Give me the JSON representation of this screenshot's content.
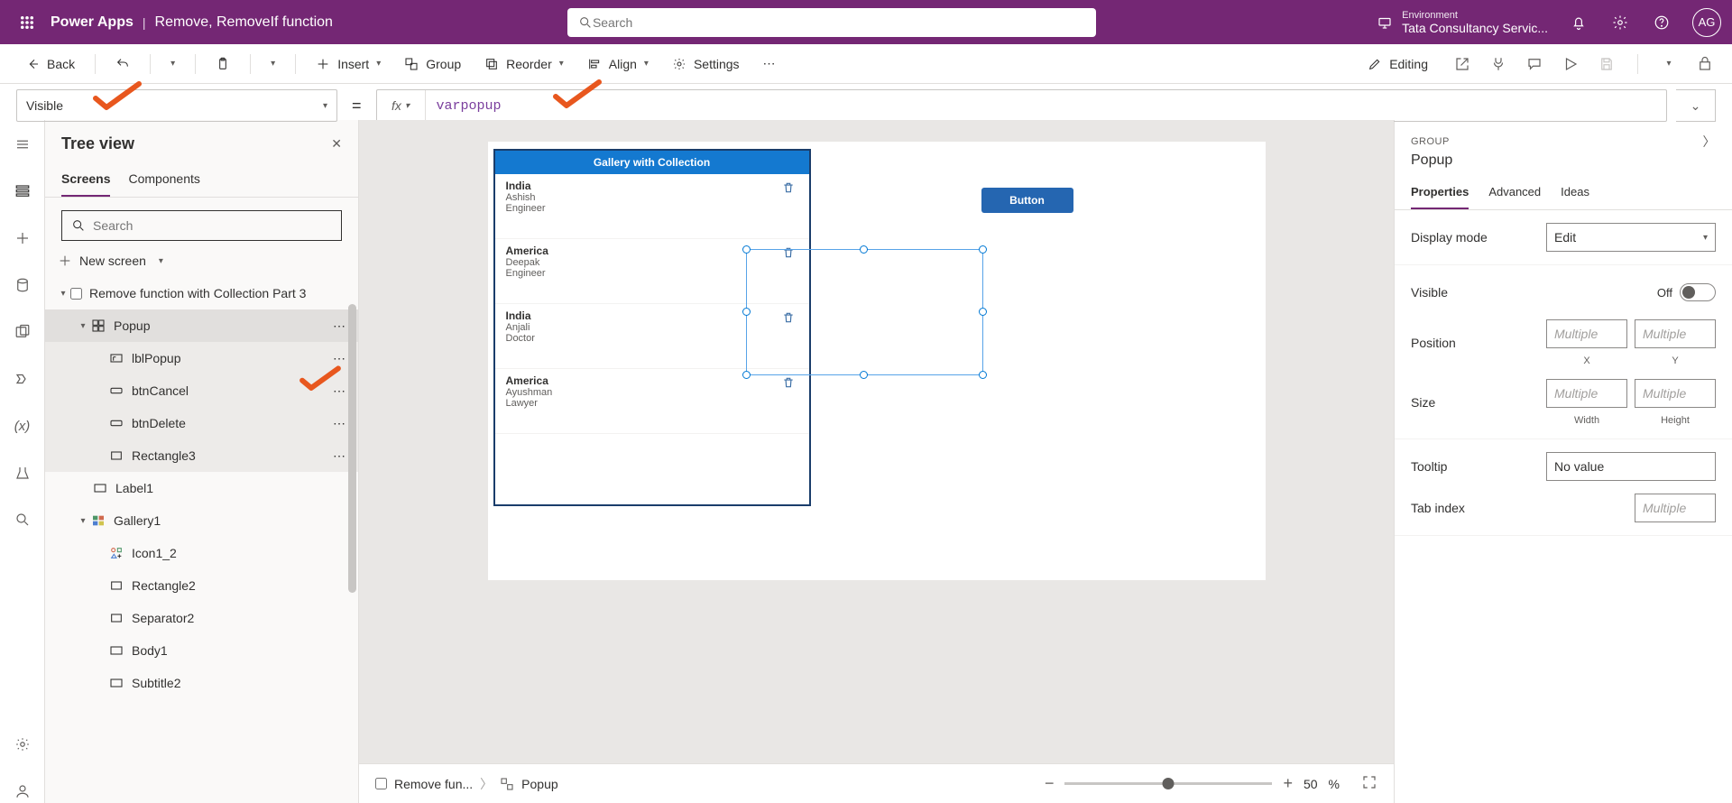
{
  "titlebar": {
    "app": "Power Apps",
    "doc": "Remove, RemoveIf function",
    "search_ph": "Search",
    "env_label": "Environment",
    "env_value": "Tata Consultancy Servic...",
    "avatar": "AG"
  },
  "ribbon": {
    "back": "Back",
    "insert": "Insert",
    "group": "Group",
    "reorder": "Reorder",
    "align": "Align",
    "settings": "Settings",
    "editing": "Editing"
  },
  "formula": {
    "property": "Visible",
    "fx": "fx",
    "value": "varpopup"
  },
  "tree": {
    "title": "Tree view",
    "tabs": {
      "screens": "Screens",
      "components": "Components"
    },
    "search_ph": "Search",
    "new_screen": "New screen",
    "root": "Remove function with Collection Part 3",
    "nodes": {
      "popup": "Popup",
      "lbl": "lblPopup",
      "cancel": "btnCancel",
      "delete": "btnDelete",
      "rect3": "Rectangle3",
      "label1": "Label1",
      "gallery1": "Gallery1",
      "icon12": "Icon1_2",
      "rect2": "Rectangle2",
      "sep2": "Separator2",
      "body1": "Body1",
      "sub2": "Subtitle2"
    }
  },
  "canvas": {
    "gallery_title": "Gallery with Collection",
    "rows": [
      {
        "country": "India",
        "name": "Ashish",
        "role": "Engineer"
      },
      {
        "country": "America",
        "name": "Deepak",
        "role": "Engineer"
      },
      {
        "country": "India",
        "name": "Anjali",
        "role": "Doctor"
      },
      {
        "country": "America",
        "name": "Ayushman",
        "role": "Lawyer"
      }
    ],
    "button_label": "Button"
  },
  "footer": {
    "crumb1": "Remove fun...",
    "crumb2": "Popup",
    "zoom": "50",
    "pct": "%"
  },
  "props": {
    "type": "GROUP",
    "name": "Popup",
    "tabs": {
      "p": "Properties",
      "a": "Advanced",
      "i": "Ideas"
    },
    "display_mode_lab": "Display mode",
    "display_mode_val": "Edit",
    "visible_lab": "Visible",
    "visible_val": "Off",
    "position_lab": "Position",
    "x_lab": "X",
    "y_lab": "Y",
    "size_lab": "Size",
    "w_lab": "Width",
    "h_lab": "Height",
    "tooltip_lab": "Tooltip",
    "tooltip_val": "No value",
    "tabindex_lab": "Tab index",
    "multiple": "Multiple"
  }
}
